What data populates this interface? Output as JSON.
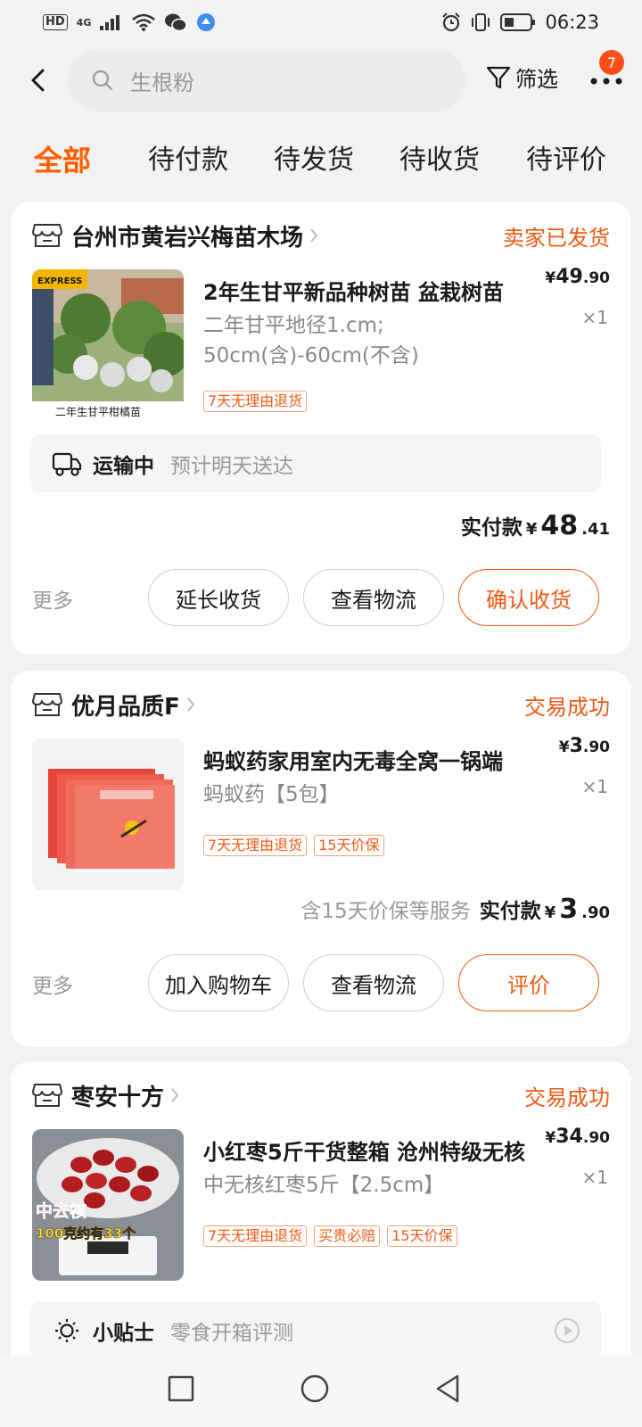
{
  "status_bar": {
    "hd": "HD",
    "signal": "4G",
    "time": "06:23"
  },
  "search": {
    "placeholder": "生根粉"
  },
  "header": {
    "filter_label": "筛选",
    "more_badge": "7"
  },
  "tabs": [
    {
      "label": "全部",
      "active": true
    },
    {
      "label": "待付款",
      "active": false
    },
    {
      "label": "待发货",
      "active": false
    },
    {
      "label": "待收货",
      "active": false
    },
    {
      "label": "待评价",
      "active": false
    }
  ],
  "orders": [
    {
      "shop": "台州市黄岩兴梅苗木场",
      "status": "卖家已发货",
      "product": {
        "title": "2年生甘平新品种树苗 盆栽树苗",
        "price_int": "49",
        "price_cents": ".90",
        "qty": "×1",
        "spec_line1": "二年甘平地径1.cm;",
        "spec_line2": "50cm(含)-60cm(不含)",
        "tags": [
          "7天无理由退货"
        ],
        "thumb_caption": "二年生甘平柑橘苗",
        "thumb_badge": "EXPRESS"
      },
      "shipping": {
        "label": "运输中",
        "eta": "预计明天送达"
      },
      "paid": {
        "label": "实付款",
        "yen": "¥",
        "int": "48",
        "cents": ".41"
      },
      "more": "更多",
      "buttons": [
        "延长收货",
        "查看物流",
        "确认收货"
      ]
    },
    {
      "shop": "优月品质F",
      "status": "交易成功",
      "product": {
        "title": "蚂蚁药家用室内无毒全窝一锅端",
        "price_int": "3",
        "price_cents": ".90",
        "qty": "×1",
        "spec_line1": "蚂蚁药【5包】",
        "tags": [
          "7天无理由退货",
          "15天价保"
        ]
      },
      "paid": {
        "note": "含15天价保等服务",
        "label": "实付款",
        "yen": "¥",
        "int": "3",
        "cents": ".90"
      },
      "more": "更多",
      "buttons": [
        "加入购物车",
        "查看物流",
        "评价"
      ]
    },
    {
      "shop": "枣安十方",
      "status": "交易成功",
      "product": {
        "title": "小红枣5斤干货整箱 沧州特级无核",
        "price_int": "34",
        "price_cents": ".90",
        "qty": "×1",
        "spec_line1": "中无核红枣5斤【2.5cm】",
        "tags": [
          "7天无理由退货",
          "买贵必赔",
          "15天价保"
        ],
        "thumb_text1": "中去核",
        "thumb_text2": "100克约有33个"
      },
      "tip": {
        "label": "小贴士",
        "text": "零食开箱评测"
      }
    }
  ],
  "price_yen": "¥",
  "colors": {
    "accent": "#f05a14",
    "tab_active": "#ff5e00",
    "badge": "#ff4d1a"
  }
}
